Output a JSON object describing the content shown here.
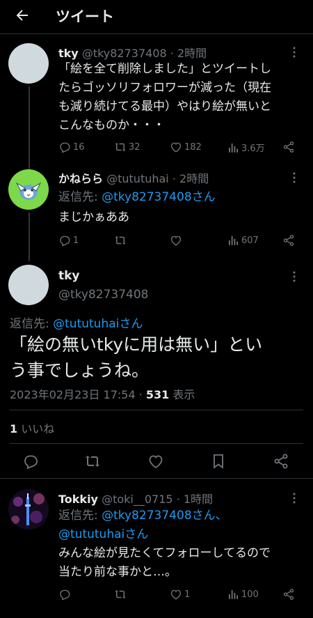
{
  "header": {
    "title": "ツイート"
  },
  "tweet1": {
    "name": "tky",
    "handle": "@tky82737408",
    "dot": "·",
    "time": "2時間",
    "lines": [
      "「絵を全て削除しました」とツイートし",
      "たらゴッソリフォロワーが減った（現在",
      "も減り続けてる最中）やはり絵が無いと",
      "こんなものか・・・"
    ],
    "replies": "16",
    "retweets": "32",
    "likes": "182",
    "views": "3.6万"
  },
  "tweet2": {
    "name": "かねらら",
    "handle": "@tututuhai",
    "dot": "·",
    "time": "2時間",
    "reply_prefix": "返信先: ",
    "reply_link": "@tky82737408さん",
    "text": "まじかぁああ",
    "replies": "1",
    "views": "607"
  },
  "focus": {
    "name": "tky",
    "handle": "@tky82737408",
    "reply_prefix": "返信先: ",
    "reply_link": "@tututuhaiさん",
    "lines": [
      "「絵の無いtkyに用は無い」とい",
      "う事でしょうね。"
    ],
    "datetime": "2023年02月23日 17:54 · ",
    "views_count": "531",
    "views_label": " 表示",
    "likes_count": "1",
    "likes_label": " いいね"
  },
  "tweet3": {
    "name": "Tokkiy",
    "handle": "@toki__0715",
    "dot": "·",
    "time": "1時間",
    "reply_prefix": "返信先: ",
    "reply_link1": "@tky82737408さん、",
    "reply_link2": "@tututuhaiさん",
    "lines": [
      "みんな絵が見たくてフォローしてるので",
      "当たり前な事かと…。"
    ],
    "likes": "1",
    "views": "100"
  }
}
